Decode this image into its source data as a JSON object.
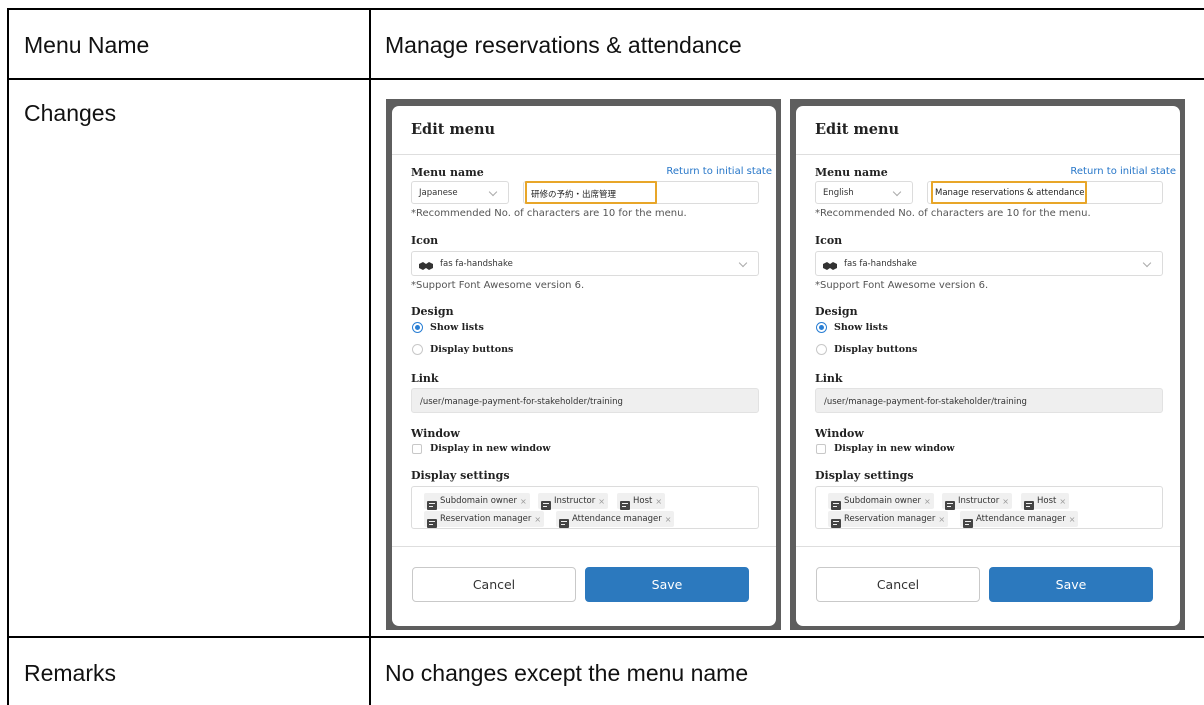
{
  "table": {
    "row1_label": "Menu Name",
    "row1_value": "Manage reservations & attendance",
    "row2_label": "Changes",
    "row3_label": "Remarks",
    "row3_value": "No changes except the menu name"
  },
  "panels": [
    {
      "title": "Edit menu",
      "menu_name_label": "Menu name",
      "return_link": "Return to initial state",
      "language": "Japanese",
      "menu_name_value": "研修の予約・出席管理",
      "name_note": "*Recommended No. of characters are 10 for the menu.",
      "icon_label": "Icon",
      "icon_value": "fas fa-handshake",
      "icon_note": "*Support Font Awesome version 6.",
      "design_label": "Design",
      "design_option_lists": "Show lists",
      "design_option_buttons": "Display buttons",
      "link_label": "Link",
      "link_value": "/user/manage-payment-for-stakeholder/training",
      "window_label": "Window",
      "window_option": "Display in new window",
      "display_label": "Display settings",
      "tags": [
        "Subdomain owner",
        "Instructor",
        "Host",
        "Reservation manager",
        "Attendance manager"
      ],
      "tag_remove": "×",
      "cancel_label": "Cancel",
      "save_label": "Save"
    },
    {
      "title": "Edit menu",
      "menu_name_label": "Menu name",
      "return_link": "Return to initial state",
      "language": "English",
      "menu_name_value": "Manage reservations & attendance",
      "name_note": "*Recommended No. of characters are 10 for the menu.",
      "icon_label": "Icon",
      "icon_value": "fas fa-handshake",
      "icon_note": "*Support Font Awesome version 6.",
      "design_label": "Design",
      "design_option_lists": "Show lists",
      "design_option_buttons": "Display buttons",
      "link_label": "Link",
      "link_value": "/user/manage-payment-for-stakeholder/training",
      "window_label": "Window",
      "window_option": "Display in new window",
      "display_label": "Display settings",
      "tags": [
        "Subdomain owner",
        "Instructor",
        "Host",
        "Reservation manager",
        "Attendance manager"
      ],
      "tag_remove": "×",
      "cancel_label": "Cancel",
      "save_label": "Save"
    }
  ],
  "colors": {
    "accent": "#2c79be",
    "link": "#2676c8",
    "highlight": "#e8a629"
  }
}
